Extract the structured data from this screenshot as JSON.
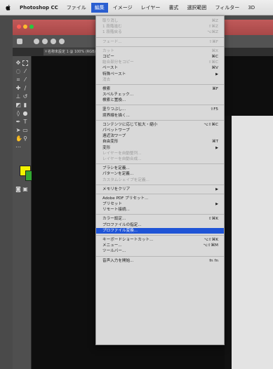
{
  "menubar": {
    "app_name": "Photoshop CC",
    "items": [
      "ファイル",
      "編集",
      "イメージ",
      "レイヤー",
      "書式",
      "選択範囲",
      "フィルター",
      "3D"
    ],
    "active_index": 1
  },
  "document_tab": {
    "title": "名称未設定 1 @ 100% (RGB/8)"
  },
  "colors": {
    "foreground": "#f2f200",
    "background": "#32a832",
    "menu_highlight": "#1f54d6",
    "titlebar": "#b05050"
  },
  "edit_menu": {
    "groups": [
      [
        {
          "label": "取り消し",
          "shortcut": "⌘Z",
          "disabled": true
        },
        {
          "label": "1 段階進む",
          "shortcut": "⇧⌘Z",
          "disabled": true
        },
        {
          "label": "1 段階戻る",
          "shortcut": "⌥⌘Z",
          "disabled": true
        }
      ],
      [
        {
          "label": "フェード...",
          "shortcut": "⇧⌘F",
          "disabled": true
        }
      ],
      [
        {
          "label": "カット",
          "shortcut": "⌘X",
          "disabled": true
        },
        {
          "label": "コピー",
          "shortcut": "⌘C",
          "disabled": false
        },
        {
          "label": "結合部分をコピー",
          "shortcut": "⇧⌘C",
          "disabled": true
        },
        {
          "label": "ペースト",
          "shortcut": "⌘V",
          "disabled": false
        },
        {
          "label": "特殊ペースト",
          "shortcut": "▶",
          "disabled": false
        },
        {
          "label": "消去",
          "shortcut": "",
          "disabled": true
        }
      ],
      [
        {
          "label": "検索",
          "shortcut": "⌘F",
          "disabled": false
        },
        {
          "label": "スペルチェック...",
          "shortcut": "",
          "disabled": false
        },
        {
          "label": "検索と置換...",
          "shortcut": "",
          "disabled": false
        }
      ],
      [
        {
          "label": "塗りつぶし...",
          "shortcut": "⇧F5",
          "disabled": false
        },
        {
          "label": "境界線を描く...",
          "shortcut": "",
          "disabled": false
        }
      ],
      [
        {
          "label": "コンテンツに応じて拡大・縮小",
          "shortcut": "⌥⇧⌘C",
          "disabled": false
        },
        {
          "label": "パペットワープ",
          "shortcut": "",
          "disabled": false
        },
        {
          "label": "遠近法ワープ",
          "shortcut": "",
          "disabled": false
        },
        {
          "label": "自由変形",
          "shortcut": "⌘T",
          "disabled": false
        },
        {
          "label": "変形",
          "shortcut": "▶",
          "disabled": false
        },
        {
          "label": "レイヤーを自動整列...",
          "shortcut": "",
          "disabled": true
        },
        {
          "label": "レイヤーを自動合成...",
          "shortcut": "",
          "disabled": true
        }
      ],
      [
        {
          "label": "ブラシを定義...",
          "shortcut": "",
          "disabled": false
        },
        {
          "label": "パターンを定義...",
          "shortcut": "",
          "disabled": false
        },
        {
          "label": "カスタムシェイプを定義...",
          "shortcut": "",
          "disabled": true
        }
      ],
      [
        {
          "label": "メモリをクリア",
          "shortcut": "▶",
          "disabled": false
        }
      ],
      [
        {
          "label": "Adobe PDF プリセット...",
          "shortcut": "",
          "disabled": false
        },
        {
          "label": "プリセット",
          "shortcut": "▶",
          "disabled": false
        },
        {
          "label": "リモート接続...",
          "shortcut": "",
          "disabled": false
        }
      ],
      [
        {
          "label": "カラー設定...",
          "shortcut": "⇧⌘K",
          "disabled": false
        },
        {
          "label": "プロファイルの指定...",
          "shortcut": "",
          "disabled": false
        },
        {
          "label": "プロファイル変換...",
          "shortcut": "",
          "disabled": false,
          "highlight": true
        }
      ],
      [
        {
          "label": "キーボードショートカット...",
          "shortcut": "⌥⇧⌘K",
          "disabled": false
        },
        {
          "label": "メニュー...",
          "shortcut": "⌥⇧⌘M",
          "disabled": false
        },
        {
          "label": "ツールバー...",
          "shortcut": "",
          "disabled": false
        }
      ],
      [
        {
          "label": "音声入力を開始...",
          "shortcut": "fn fn",
          "disabled": false
        }
      ]
    ]
  }
}
